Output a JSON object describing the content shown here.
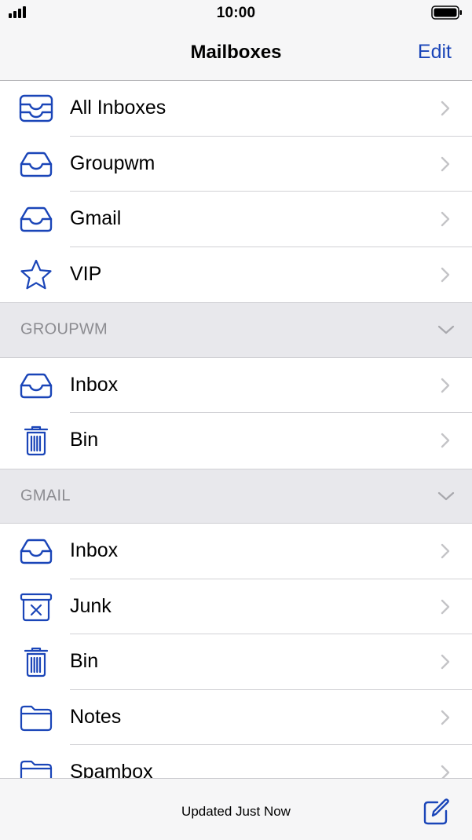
{
  "status_bar": {
    "time": "10:00"
  },
  "nav": {
    "title": "Mailboxes",
    "edit_label": "Edit"
  },
  "mailboxes": [
    {
      "label": "All Inboxes",
      "icon": "all-inboxes-icon"
    },
    {
      "label": "Groupwm",
      "icon": "inbox-tray-icon"
    },
    {
      "label": "Gmail",
      "icon": "inbox-tray-icon"
    },
    {
      "label": "VIP",
      "icon": "star-icon"
    }
  ],
  "accounts": [
    {
      "header": "GROUPWM",
      "items": [
        {
          "label": "Inbox",
          "icon": "inbox-tray-icon"
        },
        {
          "label": "Bin",
          "icon": "trash-icon"
        }
      ]
    },
    {
      "header": "GMAIL",
      "items": [
        {
          "label": "Inbox",
          "icon": "inbox-tray-icon"
        },
        {
          "label": "Junk",
          "icon": "junk-icon"
        },
        {
          "label": "Bin",
          "icon": "trash-icon"
        },
        {
          "label": "Notes",
          "icon": "folder-icon"
        },
        {
          "label": "Spambox",
          "icon": "folder-icon"
        }
      ]
    }
  ],
  "toolbar": {
    "status": "Updated Just Now"
  },
  "colors": {
    "accent": "#1a45b8",
    "section_bg": "#e8e8ec",
    "section_text": "#8c8c91",
    "chevron": "#c4c4c7"
  }
}
